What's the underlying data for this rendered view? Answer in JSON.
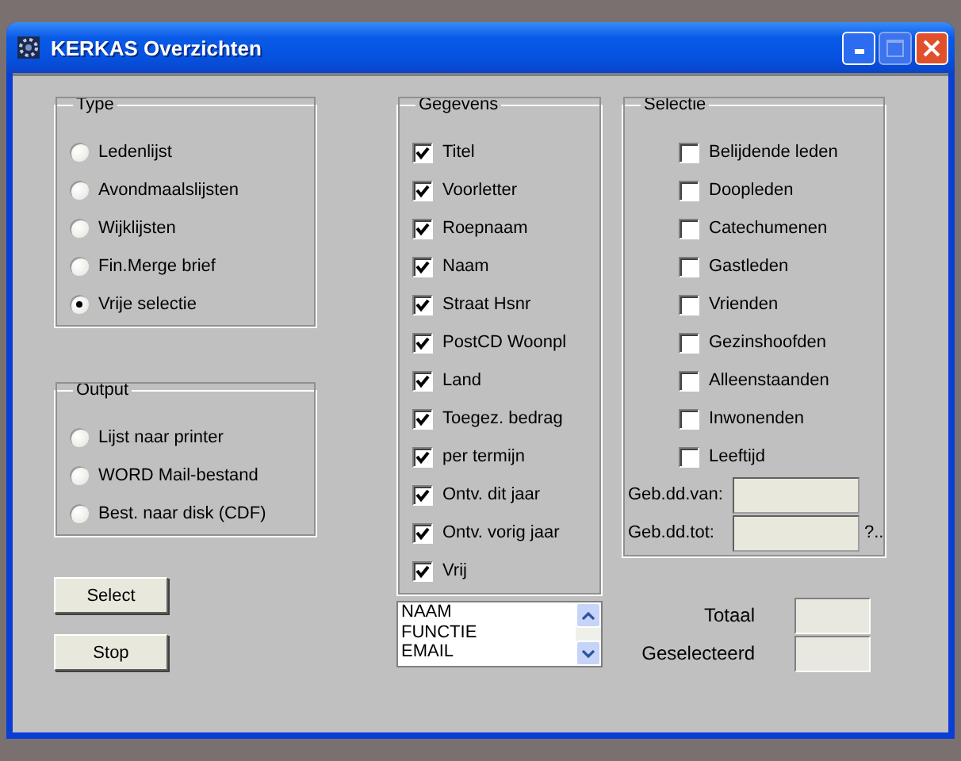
{
  "window": {
    "title": "KERKAS Overzichten"
  },
  "type_group": {
    "legend": "Type",
    "options": [
      {
        "label": "Ledenlijst",
        "selected": false
      },
      {
        "label": "Avondmaalslijsten",
        "selected": false
      },
      {
        "label": "Wijklijsten",
        "selected": false
      },
      {
        "label": "Fin.Merge brief",
        "selected": false
      },
      {
        "label": "Vrije selectie",
        "selected": true
      }
    ]
  },
  "output_group": {
    "legend": "Output",
    "options": [
      {
        "label": "Lijst naar printer",
        "selected": false
      },
      {
        "label": "WORD Mail-bestand",
        "selected": false
      },
      {
        "label": "Best. naar disk (CDF)",
        "selected": false
      }
    ]
  },
  "buttons": [
    "Select",
    "Stop"
  ],
  "gegevens": {
    "legend": "Gegevens",
    "items": [
      {
        "label": "Titel",
        "checked": true
      },
      {
        "label": "Voorletter",
        "checked": true
      },
      {
        "label": "Roepnaam",
        "checked": true
      },
      {
        "label": "Naam",
        "checked": true
      },
      {
        "label": "Straat Hsnr",
        "checked": true
      },
      {
        "label": "PostCD Woonpl",
        "checked": true
      },
      {
        "label": "Land",
        "checked": true
      },
      {
        "label": "Toegez. bedrag",
        "checked": true
      },
      {
        "label": "per termijn",
        "checked": true
      },
      {
        "label": "Ontv. dit jaar",
        "checked": true
      },
      {
        "label": "Ontv. vorig jaar",
        "checked": true
      },
      {
        "label": "Vrij",
        "checked": true
      }
    ]
  },
  "field_list": [
    "NAAM",
    "FUNCTIE",
    "EMAIL"
  ],
  "selectie": {
    "legend": "Selectie",
    "items": [
      {
        "label": "Belijdende leden",
        "checked": false
      },
      {
        "label": "Doopleden",
        "checked": false
      },
      {
        "label": "Catechumenen",
        "checked": false
      },
      {
        "label": "Gastleden",
        "checked": false
      },
      {
        "label": "Vrienden",
        "checked": false
      },
      {
        "label": "Gezinshoofden",
        "checked": false
      },
      {
        "label": "Alleenstaanden",
        "checked": false
      },
      {
        "label": "Inwonenden",
        "checked": false
      },
      {
        "label": "Leeftijd",
        "checked": false
      }
    ],
    "date_from": {
      "label": "Geb.dd.van:"
    },
    "date_to": {
      "label": "Geb.dd.tot:",
      "suffix": "?.."
    }
  },
  "totals": [
    {
      "label": "Totaal"
    },
    {
      "label": "Geselecteerd"
    }
  ]
}
